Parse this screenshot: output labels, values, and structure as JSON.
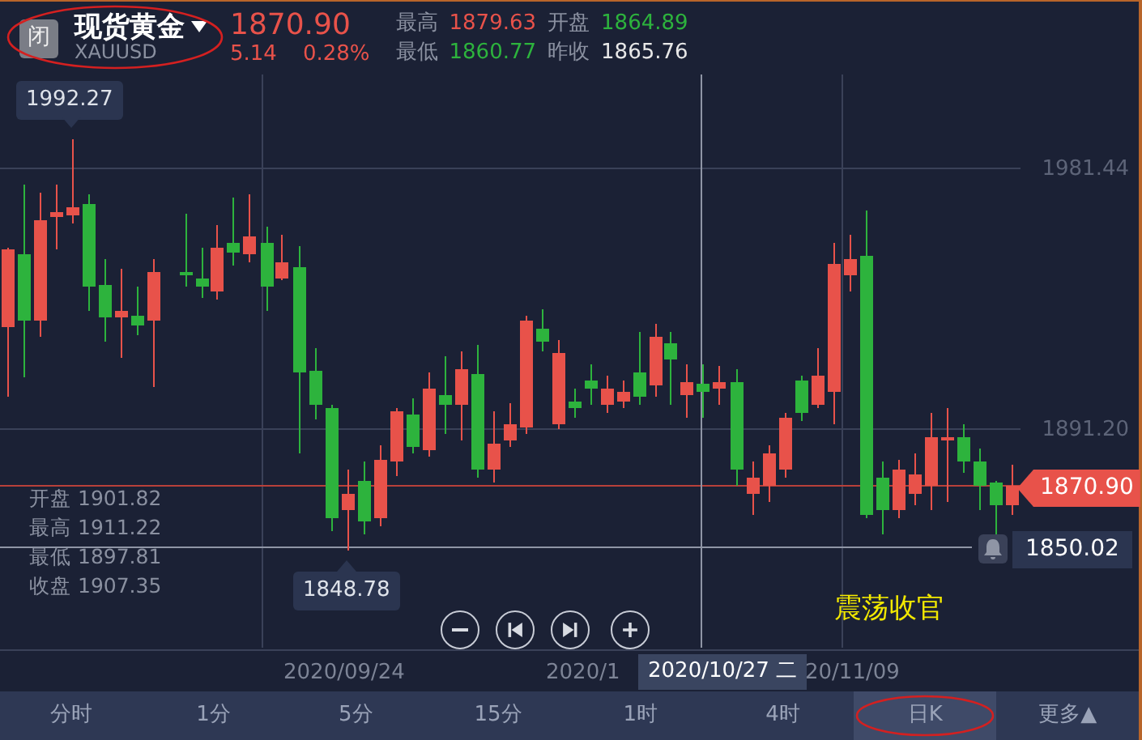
{
  "header": {
    "status_badge": "闭",
    "title": "现货黄金",
    "symbol": "XAUUSD",
    "circled": true,
    "price": "1870.90",
    "change": "5.14",
    "change_pct": "0.28%",
    "color": "#e8524a",
    "stats": [
      {
        "label": "最高",
        "value": "1879.63",
        "color": "#e8524a"
      },
      {
        "label": "开盘",
        "value": "1864.89",
        "color": "#2db33d"
      },
      {
        "label": "最低",
        "value": "1860.77",
        "color": "#2db33d"
      },
      {
        "label": "昨收",
        "value": "1865.76",
        "color": "#e8e8e8"
      }
    ]
  },
  "chart": {
    "y_labels": [
      "1981.44",
      "1891.20"
    ],
    "high_marker": "1992.27",
    "low_marker": "1848.78",
    "last_price": "1870.90",
    "crosshair_price": "1850.02",
    "crosshair_info": [
      {
        "label": "开盘",
        "value": "1901.82"
      },
      {
        "label": "最高",
        "value": "1911.22"
      },
      {
        "label": "最低",
        "value": "1897.81"
      },
      {
        "label": "收盘",
        "value": "1907.35"
      }
    ],
    "controls": [
      {
        "kind": "zoom-out"
      },
      {
        "kind": "previous"
      },
      {
        "kind": "next"
      },
      {
        "kind": "zoom-in"
      }
    ],
    "note": "震荡收官",
    "x_labels": [
      "2020/09/24",
      "2020/1",
      "20/11/09"
    ],
    "crosshair_date": "2020/10/27 二"
  },
  "timeframes": [
    {
      "label": "分时",
      "selected": false,
      "circled": false
    },
    {
      "label": "1分",
      "selected": false,
      "circled": false
    },
    {
      "label": "5分",
      "selected": false,
      "circled": false
    },
    {
      "label": "15分",
      "selected": false,
      "circled": false
    },
    {
      "label": "1时",
      "selected": false,
      "circled": false
    },
    {
      "label": "4时",
      "selected": false,
      "circled": false
    },
    {
      "label": "日K",
      "selected": true,
      "circled": true
    },
    {
      "label": "更多▲",
      "selected": false,
      "circled": false
    }
  ]
}
